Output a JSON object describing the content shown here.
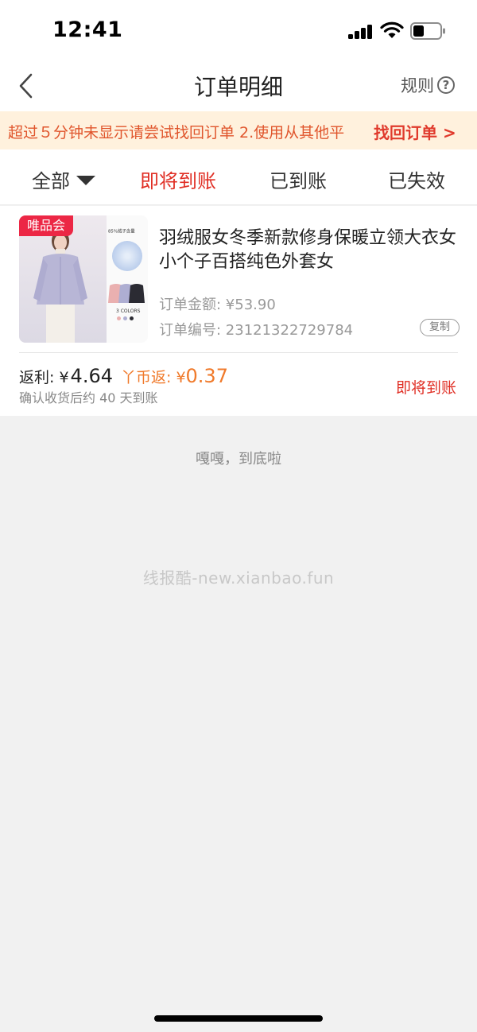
{
  "status_bar": {
    "time": "12:41"
  },
  "nav": {
    "title": "订单明细",
    "rules_label": "规则",
    "help_glyph": "?"
  },
  "notice": {
    "text": "超过５分钟未显示请尝试找回订单 2.使用从其他平",
    "link": "找回订单 >"
  },
  "tabs": [
    {
      "label": "全部"
    },
    {
      "label": "即将到账"
    },
    {
      "label": "已到账"
    },
    {
      "label": "已失效"
    }
  ],
  "order": {
    "badge": "唯品会",
    "thumb_caption": "85%绒子含量",
    "thumb_colors": "3 COLORS",
    "title": "羽绒服女冬季新款修身保暖立领大衣女小个子百搭纯色外套女",
    "amount": "订单金额: ¥53.90",
    "order_no": "订单编号: 23121322729784",
    "copy_label": "复制",
    "rebate_label": "返利: ",
    "rebate_currency": "¥",
    "rebate_value": "4.64",
    "coin_label": "丫币返: ¥",
    "coin_value": "0.37",
    "arrival_note": "确认收货后约 40 天到账",
    "status": "即将到账"
  },
  "end_text": "嘎嘎，到底啦",
  "watermark": "线报酷-new.xianbao.fun",
  "colors": {
    "accent_red": "#e02e24",
    "orange": "#f07a2b",
    "notice_bg": "#fff1dd",
    "badge_red": "#ec2745"
  },
  "icons": [
    "back-arrow-icon",
    "help-circle-icon",
    "dropdown-caret-icon",
    "signal-icon",
    "wifi-icon",
    "battery-icon"
  ]
}
